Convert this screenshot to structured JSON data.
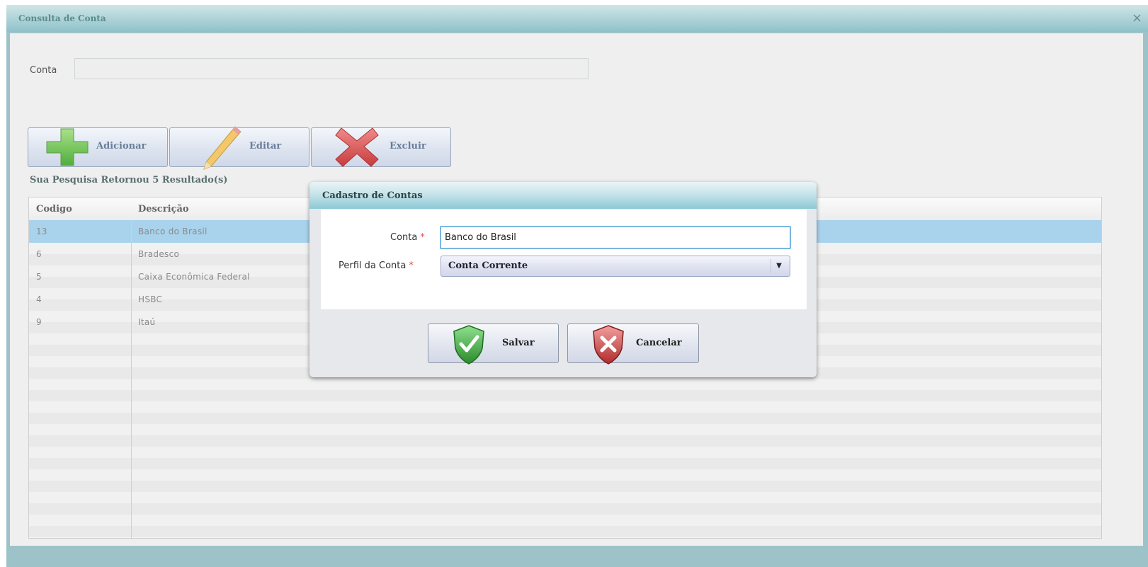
{
  "window": {
    "title": "Consulta de Conta",
    "close_label": "×"
  },
  "search": {
    "label": "Conta",
    "value": ""
  },
  "toolbar": {
    "add_label": "Adicionar",
    "edit_label": "Editar",
    "delete_label": "Excluir"
  },
  "results": {
    "summary": "Sua Pesquisa Retornou 5 Resultado(s)",
    "columns": [
      "Codigo",
      "Descrição"
    ],
    "rows": [
      {
        "codigo": "13",
        "descricao": "Banco do Brasil",
        "selected": true
      },
      {
        "codigo": "6",
        "descricao": "Bradesco",
        "selected": false
      },
      {
        "codigo": "5",
        "descricao": "Caixa Econômica Federal",
        "selected": false
      },
      {
        "codigo": "4",
        "descricao": "HSBC",
        "selected": false
      },
      {
        "codigo": "9",
        "descricao": "Itaú",
        "selected": false
      }
    ]
  },
  "dialog": {
    "title": "Cadastro de Contas",
    "conta_label": "Conta",
    "conta_value": "Banco do Brasil",
    "perfil_label": "Perfil da Conta",
    "perfil_value": "Conta Corrente",
    "required_mark": "*",
    "save_label": "Salvar",
    "cancel_label": "Cancelar"
  },
  "colors": {
    "selected_row": "#a9d3ec",
    "title_bar": "#a9d0d6",
    "save_icon": "#3aa53a",
    "cancel_icon": "#c93a3a"
  }
}
